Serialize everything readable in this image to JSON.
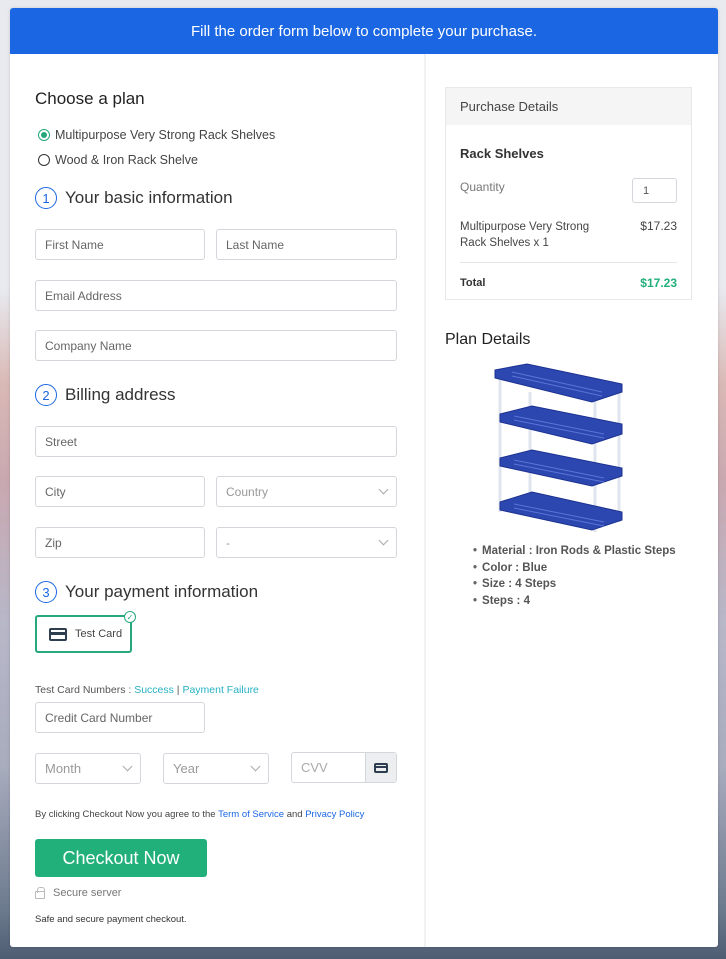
{
  "banner": {
    "text": "Fill the order form below to complete your purchase."
  },
  "plan": {
    "heading": "Choose a plan",
    "options": [
      {
        "label": "Multipurpose Very Strong Rack Shelves",
        "selected": true
      },
      {
        "label": "Wood & Iron Rack Shelve",
        "selected": false
      }
    ]
  },
  "basic": {
    "step": "1",
    "heading": "Your basic information",
    "first_name_placeholder": "First Name",
    "last_name_placeholder": "Last Name",
    "email_placeholder": "Email Address",
    "company_placeholder": "Company Name"
  },
  "billing": {
    "step": "2",
    "heading": "Billing address",
    "street_placeholder": "Street",
    "city_placeholder": "City",
    "country_selected": "Country",
    "zip_placeholder": "Zip",
    "state_selected": "-"
  },
  "payment": {
    "step": "3",
    "heading": "Your payment information",
    "card_option_label": "Test Card",
    "test_numbers_label": "Test Card Numbers : ",
    "success_link": "Success",
    "separator": " | ",
    "failure_link": "Payment Failure",
    "card_number_placeholder": "Credit Card Number",
    "month_selected": "Month",
    "year_selected": "Year",
    "cvv_placeholder": "CVV"
  },
  "agreement": {
    "prefix": "By clicking Checkout Now you agree to the ",
    "terms_link": "Term of Service",
    "and": " and ",
    "privacy_link": "Privacy Policy"
  },
  "checkout_label": "Checkout Now",
  "secure_label": "Secure server",
  "safe_text": "Safe and secure payment checkout.",
  "purchase": {
    "heading": "Purchase Details",
    "product_title": "Rack Shelves",
    "quantity_label": "Quantity",
    "quantity_value": "1",
    "item_label": "Multipurpose Very Strong Rack Shelves x 1",
    "item_price": "$17.23",
    "total_label": "Total",
    "total_value": "$17.23"
  },
  "plan_details": {
    "heading": "Plan Details",
    "image_alt": "Blue 4-step rack shelves",
    "specs": [
      "Material : Iron Rods & Plastic Steps",
      "Color : Blue",
      "Size : 4 Steps",
      "Steps : 4"
    ]
  },
  "colors": {
    "primary": "#1b67e3",
    "success": "#22b07a",
    "link": "#27b1c4"
  }
}
